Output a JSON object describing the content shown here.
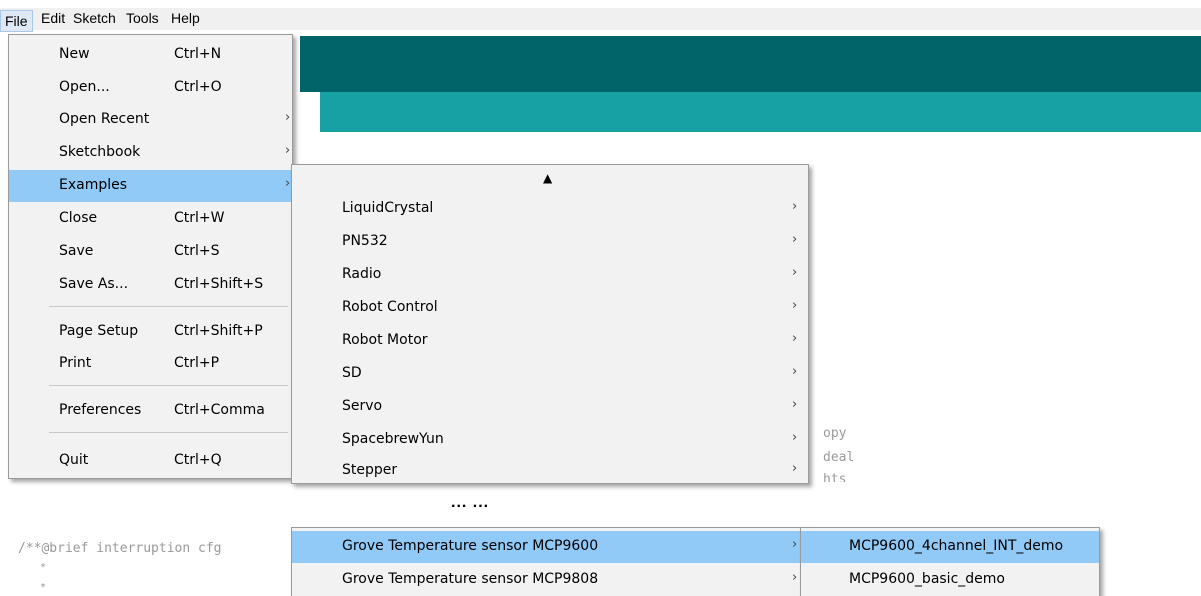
{
  "menubar": {
    "items": [
      "File",
      "Edit",
      "Sketch",
      "Tools",
      "Help"
    ]
  },
  "file_menu": {
    "items": [
      {
        "label": "New",
        "shortcut": "Ctrl+N"
      },
      {
        "label": "Open...",
        "shortcut": "Ctrl+O"
      },
      {
        "label": "Open Recent",
        "submenu": "›"
      },
      {
        "label": "Sketchbook",
        "submenu": "›"
      },
      {
        "label": "Examples",
        "submenu": "›"
      },
      {
        "label": "Close",
        "shortcut": "Ctrl+W"
      },
      {
        "label": "Save",
        "shortcut": "Ctrl+S"
      },
      {
        "label": "Save As...",
        "shortcut": "Ctrl+Shift+S"
      },
      {
        "label": "Page Setup",
        "shortcut": "Ctrl+Shift+P"
      },
      {
        "label": "Print",
        "shortcut": "Ctrl+P"
      },
      {
        "label": "Preferences",
        "shortcut": "Ctrl+Comma"
      },
      {
        "label": "Quit",
        "shortcut": "Ctrl+Q"
      }
    ]
  },
  "examples_menu": {
    "scroll_up": "▲",
    "items": [
      {
        "label": "LiquidCrystal",
        "submenu": "›"
      },
      {
        "label": "PN532",
        "submenu": "›"
      },
      {
        "label": "Radio",
        "submenu": "›"
      },
      {
        "label": "Robot Control",
        "submenu": "›"
      },
      {
        "label": "Robot Motor",
        "submenu": "›"
      },
      {
        "label": "SD",
        "submenu": "›"
      },
      {
        "label": "Servo",
        "submenu": "›"
      },
      {
        "label": "SpacebrewYun",
        "submenu": "›"
      },
      {
        "label": "Stepper",
        "submenu": "›"
      }
    ]
  },
  "ellipsis": "... ...",
  "examples_menu_lower": {
    "items": [
      {
        "label": "Grove Temperature sensor MCP9600",
        "submenu": "›"
      },
      {
        "label": "Grove Temperature sensor MCP9808",
        "submenu": "›"
      }
    ]
  },
  "mcp9600_menu": {
    "items": [
      {
        "label": "MCP9600_4channel_INT_demo"
      },
      {
        "label": "MCP9600_basic_demo"
      }
    ]
  },
  "code": {
    "right_lines": [
      "opy",
      "deal",
      "hts"
    ],
    "comment_line": "/**@brief interruption cfg",
    "star_lines": [
      "*",
      "*"
    ]
  },
  "colors": {
    "toolbar": "#006468",
    "tabbar": "#17a1a5",
    "highlight": "#91c9f7"
  }
}
